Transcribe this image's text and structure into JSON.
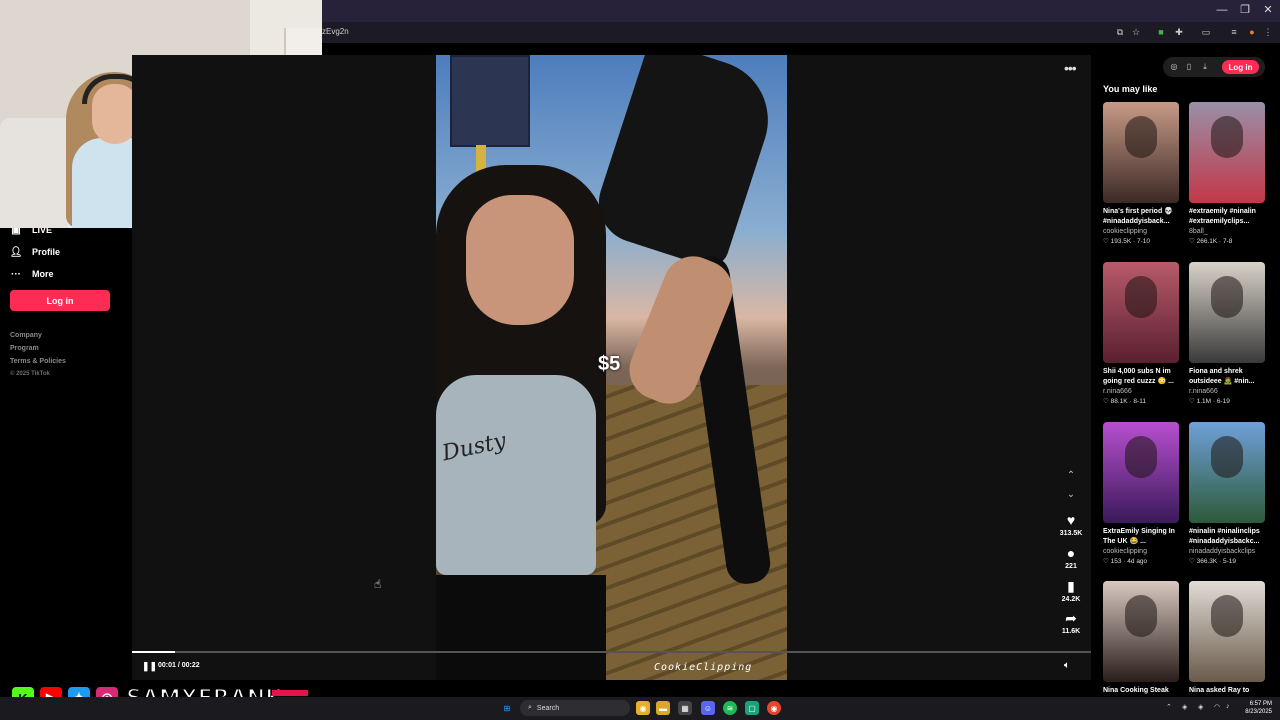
{
  "browser": {
    "url_fragment": "zEvg2n",
    "window_controls": [
      "—",
      "❐",
      "✕"
    ]
  },
  "sidebar": {
    "items": [
      {
        "label": "LIVE",
        "icon": "live-icon"
      },
      {
        "label": "Profile",
        "icon": "profile-icon"
      },
      {
        "label": "More",
        "icon": "more-icon"
      }
    ],
    "login_label": "Log in",
    "footer_links": [
      "Company",
      "Program",
      "Terms & Policies"
    ],
    "copyright": "© 2025 TikTok"
  },
  "video": {
    "overlay_price": "$5",
    "watermark": "CookieClipping",
    "shirt_text": "Dusty",
    "time": "00:01 / 00:22",
    "progress": 0.045
  },
  "actions": [
    {
      "name": "like",
      "icon": "heart-icon",
      "glyph": "♥",
      "count": "313.5K"
    },
    {
      "name": "comment",
      "icon": "comment-icon",
      "glyph": "●",
      "count": "221"
    },
    {
      "name": "save",
      "icon": "bookmark-icon",
      "glyph": "▮",
      "count": "24.2K"
    },
    {
      "name": "share",
      "icon": "share-icon",
      "glyph": "➦",
      "count": "11.6K"
    }
  ],
  "header": {
    "login_label": "Log in"
  },
  "recommendations": {
    "title": "You may like",
    "cards": [
      {
        "title": "Nina's first period 💀",
        "title2": "#ninadaddyisback...",
        "author": "cookieclipping",
        "likes": "193.5K",
        "date": "7-10",
        "color1": "#c79a86",
        "color2": "#3c2a26"
      },
      {
        "title": "#extraemily #ninalin",
        "title2": "#extraemilyclips...",
        "author": "8ball_",
        "likes": "266.1K",
        "date": "7-8",
        "color1": "#9a8fa8",
        "color2": "#c23848"
      },
      {
        "title": "Shii 4,000 subs N im",
        "title2": "going red cuzzz 😳 ...",
        "author": "r.nina666",
        "likes": "88.1K",
        "date": "8-11",
        "color1": "#b85a6a",
        "color2": "#5a2030"
      },
      {
        "title": "Fiona and shrek",
        "title2": "outsideee 🧟 #nin...",
        "author": "r.nina666",
        "likes": "1.1M",
        "date": "6-19",
        "color1": "#d8d2c8",
        "color2": "#3a3a3a"
      },
      {
        "title": "ExtraEmily Singing In",
        "title2": "The UK 😂 ...",
        "author": "cookieclipping",
        "likes": "153",
        "date": "4d ago",
        "color1": "#b84fd0",
        "color2": "#3a1a5a"
      },
      {
        "title": "#ninalin #ninalinclips",
        "title2": "#ninadaddyisbackc...",
        "author": "ninadaddyisbackclips",
        "likes": "366.3K",
        "date": "5-19",
        "color1": "#6fa0d8",
        "color2": "#2d5a3a"
      },
      {
        "title": "Nina Cooking Steak",
        "title2": "",
        "author": "",
        "likes": "",
        "date": "",
        "color1": "#d8c8c0",
        "color2": "#2a1e1a"
      },
      {
        "title": "Nina asked Ray to",
        "title2": "",
        "author": "",
        "likes": "",
        "date": "",
        "color1": "#e0dcd6",
        "color2": "#6a5a4a"
      }
    ]
  },
  "stream_overlay": {
    "handle": "SAMXFRANK",
    "socials": [
      {
        "icon": "kick-icon",
        "glyph": "K",
        "color": "#53fc18"
      },
      {
        "icon": "youtube-icon",
        "glyph": "▶",
        "color": "#ff0000"
      },
      {
        "icon": "twitter-icon",
        "glyph": "✦",
        "color": "#1d9bf0"
      },
      {
        "icon": "instagram-icon",
        "glyph": "◎",
        "color": "#d62976"
      }
    ]
  },
  "taskbar": {
    "search_label": "Search",
    "time": "6:57 PM",
    "date": "8/23/2025"
  },
  "colors": {
    "accent": "#fe2c55"
  }
}
